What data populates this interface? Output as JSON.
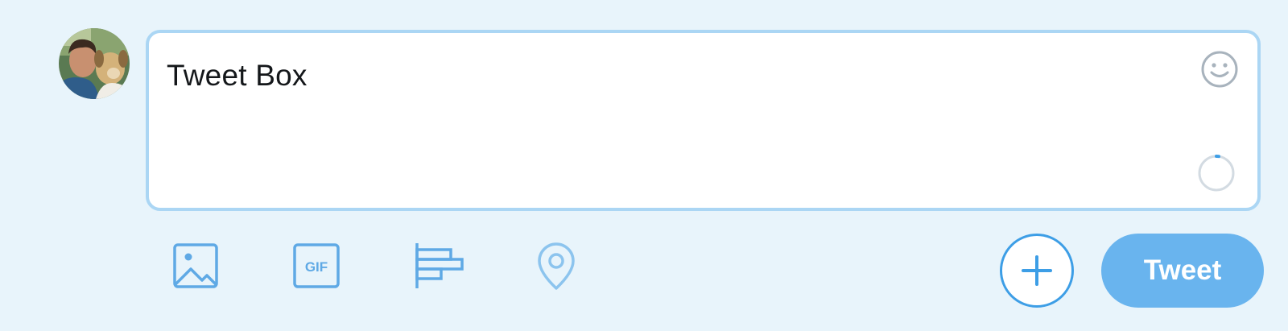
{
  "composer": {
    "text": "Tweet Box"
  },
  "toolbar": {
    "icons": [
      "image-icon",
      "gif-icon",
      "poll-icon",
      "location-icon"
    ],
    "gif_label": "GIF"
  },
  "actions": {
    "add_icon": "plus-icon",
    "tweet_label": "Tweet"
  },
  "colors": {
    "background": "#e8f4fb",
    "accent": "#3d9ee6",
    "tweet_button": "#69b4ee",
    "box_border": "#abd6f4"
  }
}
